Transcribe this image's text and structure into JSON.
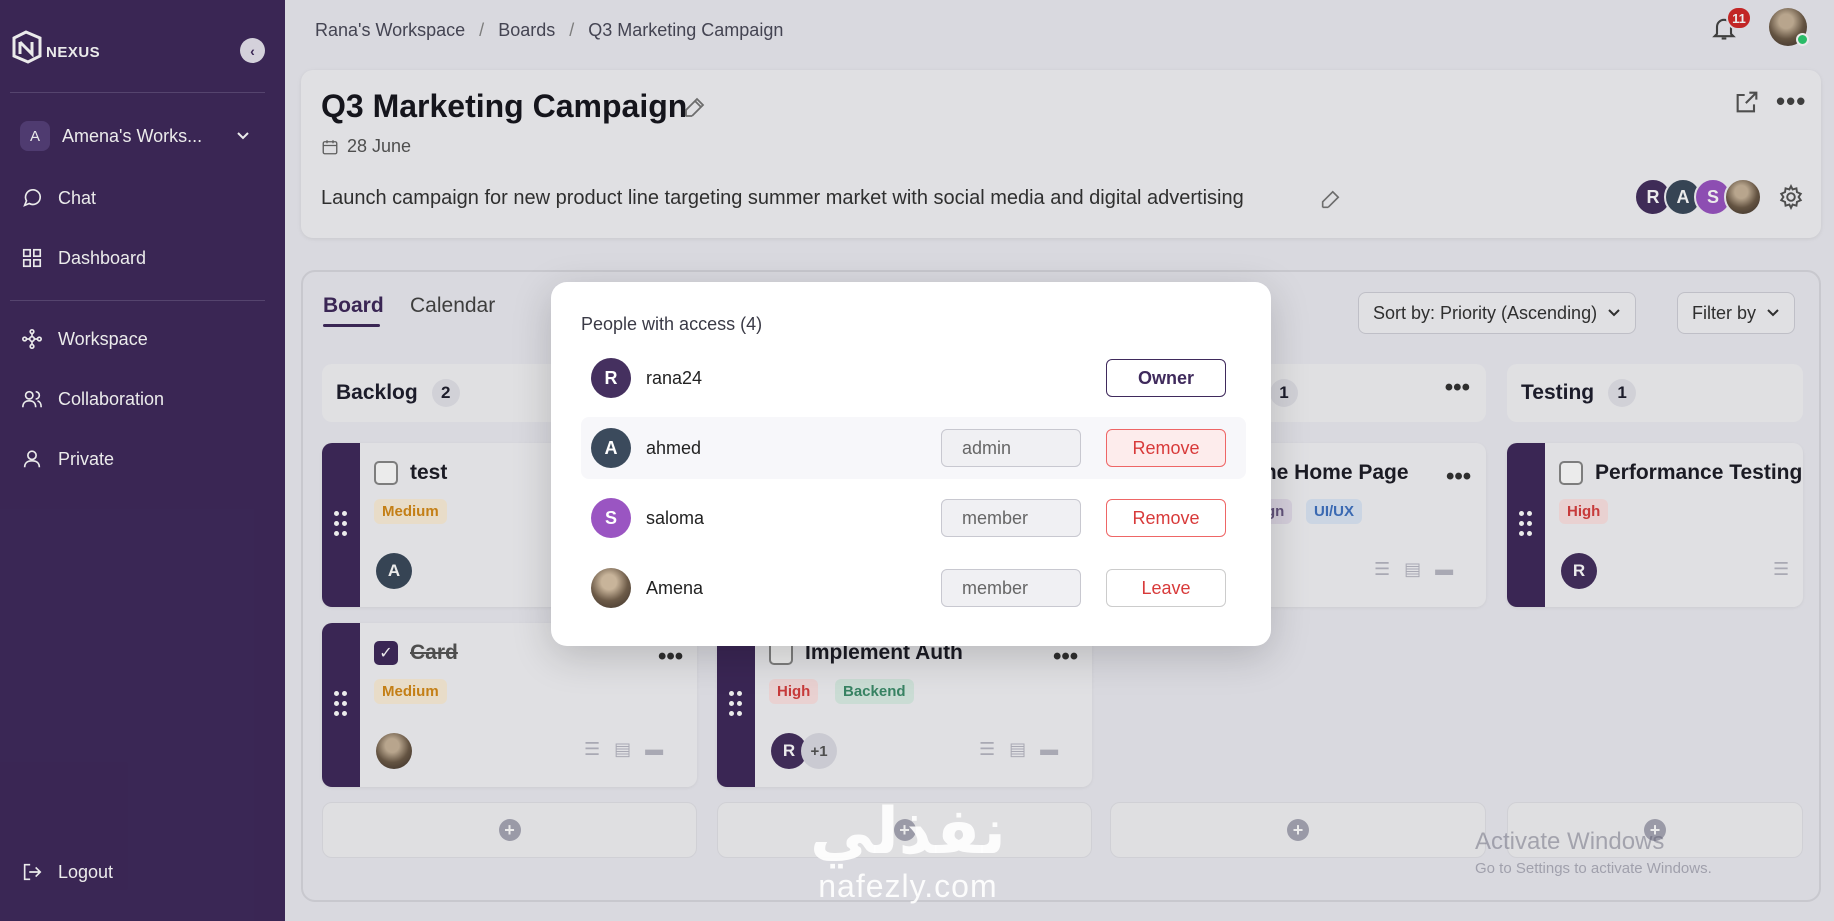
{
  "app": {
    "logo_text": "NEXUS"
  },
  "sidebar": {
    "workspace": {
      "initial": "A",
      "name": "Amena's Works..."
    },
    "items": [
      {
        "label": "Chat",
        "icon": "chat-icon"
      },
      {
        "label": "Dashboard",
        "icon": "dashboard-icon"
      },
      {
        "label": "Workspace",
        "icon": "workspace-icon"
      },
      {
        "label": "Collaboration",
        "icon": "collaboration-icon"
      },
      {
        "label": "Private",
        "icon": "user-icon"
      }
    ],
    "logout": "Logout"
  },
  "breadcrumb": [
    "Rana's Workspace",
    "Boards",
    "Q3 Marketing Campaign"
  ],
  "notifications": {
    "count": "11"
  },
  "board": {
    "title": "Q3 Marketing Campaign",
    "date": "28 June",
    "description": "Launch campaign for new product line targeting summer market with social media and digital advertising",
    "members": [
      "R",
      "A",
      "S"
    ]
  },
  "tabs": [
    "Board",
    "Calendar"
  ],
  "sort_label": "Sort by: Priority (Ascending)",
  "filter_label": "Filter by",
  "columns": [
    {
      "name": "Backlog",
      "count": "2"
    },
    {
      "name": "",
      "count": "1"
    },
    {
      "name": "Testing",
      "count": "1"
    }
  ],
  "cards": {
    "test": {
      "title": "test",
      "tag": "Medium",
      "avatar": "A"
    },
    "card": {
      "title": "Card",
      "tag": "Medium"
    },
    "auth": {
      "title": "Implement Auth",
      "tags": [
        "High",
        "Backend"
      ],
      "avatar": "R",
      "extra": "+1"
    },
    "home": {
      "title": "me Home Page",
      "tags": [
        "gn",
        "UI/UX"
      ]
    },
    "perf": {
      "title": "Performance Testing",
      "tag": "High",
      "avatar": "R"
    }
  },
  "modal": {
    "title": "People with access (4)",
    "people": [
      {
        "initial": "R",
        "name": "rana24",
        "role": "",
        "action": "Owner"
      },
      {
        "initial": "A",
        "name": "ahmed",
        "role": "admin",
        "action": "Remove"
      },
      {
        "initial": "S",
        "name": "saloma",
        "role": "member",
        "action": "Remove"
      },
      {
        "initial": "",
        "name": "Amena",
        "role": "member",
        "action": "Leave"
      }
    ]
  },
  "watermark": {
    "arabic": "نفذلي",
    "url": "nafezly.com"
  },
  "activate": {
    "line1": "Activate Windows",
    "line2": "Go to Settings to activate Windows."
  },
  "colors": {
    "sidebar": "#3f2a5c",
    "accent": "#3f2a5c",
    "danger": "#d83a3a",
    "avatar_r": "#45305f",
    "avatar_a": "#3b4a5c",
    "avatar_s": "#9a55c2"
  }
}
